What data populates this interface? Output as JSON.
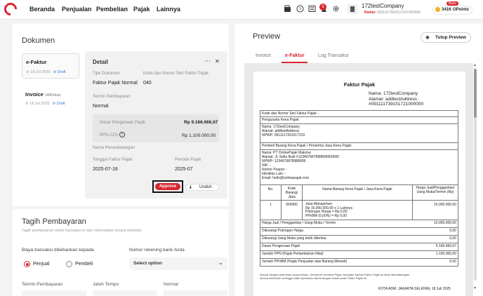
{
  "topbar": {
    "nav": [
      "Beranda",
      "Penjualan",
      "Pembelian",
      "Pajak",
      "Lainnya"
    ],
    "notif_count": "5",
    "company": "172testCompany",
    "badan_label": "Badan:",
    "badan_value": "0911117391517210-000000",
    "points": "341K OPoints",
    "baru": "Baru"
  },
  "left": {
    "dokumen_title": "Dokumen",
    "efaktur": {
      "title": "e-Faktur",
      "date": "18 Jul 2025",
      "status": "Draft"
    },
    "invoice": {
      "title": "Invoice",
      "number": "149Orkscl",
      "date": "18 Jul 2025",
      "status": "Draft"
    },
    "detail": {
      "title": "Detail",
      "tipe_label": "Tipe Dokumen",
      "tipe_value": "Faktur Pajak Normal",
      "kode_label": "Kode dan Nomor Seri Faktur Pajak",
      "kode_value": "040",
      "termin_label": "Termin Pembayaran",
      "termin_value": "Normal",
      "dpp_label": "Dasar Pengenaan Pajak",
      "dpp_value": "Rp 9.166.666,67",
      "ppn_label": "PPN-12%",
      "ppn_value": "Rp 1.100.000,00",
      "ttd_label": "Nama Penandatangan",
      "tanggal_label": "Tanggal Faktur Pajak",
      "tanggal_value": "2025-07-18",
      "periode_label": "Periode Pajak",
      "periode_value": "2025-07",
      "approve": "Approve",
      "unduh": "Unduh"
    },
    "tagih": {
      "title": "Tagih Pembayaran",
      "subtitle": "Tagih pembayaran untuk transaksi ini dan rekonsiliasi secara otomatis",
      "biaya_label": "Biaya transaksi dibebankan kepada",
      "opt1": "Penjual",
      "opt2": "Pembeli",
      "rek_label": "Nomor rekening bank Anda",
      "rek_placeholder": "Select option",
      "termin_label": "Termin Pembayaran",
      "jatuh_label": "Jatuh Tempo",
      "normal_label": "Normal"
    }
  },
  "preview": {
    "title": "Preview",
    "close": "Tutup Preview",
    "tabs": [
      "Invoice",
      "e-Faktur",
      "Log Transaksi"
    ],
    "doc": {
      "heading": "Faktur Pajak",
      "nama": "Nama: 172testCompany",
      "alamat": "Alamat: addtestAddress",
      "npwp_head": "#091111739151721000000",
      "kode": "Kode dan Nomor Seri Faktur Pajak: -",
      "pkp": "Pengusaha Kena Pajak:",
      "pkp_nama": "Nama: 172testCompany",
      "pkp_alamat": "Alamat: addtestAddress",
      "pkp_npwp": "NPWP: 0911117391517210",
      "pembeli": "Pembeli Barang Kena Pajak / Penerima Jasa Kena Pajak:",
      "b1": "Nama: PT OnlinePajak Makmur",
      "b2": "Alamat: Jl. Setia Budi #123467687898899900000",
      "b3": "NPWP: 1234676878988999",
      "b4": "NIK: -",
      "b5": "Nomor Paspor: -",
      "b6": "Identitas Lain: -",
      "b7": "Email: hello@onlinepajak.com",
      "col_no": "No.",
      "col_kode": "Kode Barang/ Jasa",
      "col_nama": "Nama Barang Kena Pajak / Jasa Kena Pajak",
      "col_harga": "Harga Jual/Penggantian/ Uang Muka/Termin (Rp)",
      "item_no": "1",
      "item_kode": "000000",
      "item_d1": "Jasa Manajemen",
      "item_d2": "Rp 10.000.000,00 x 1 Lainnya",
      "item_d3": "Potongan Harga = Rp 0,00",
      "item_d4": "PPnBM (0,00%) = Rp 0,00",
      "item_harga": "10.000.000,00",
      "t1": "Harga Jual / Penggantian / Uang Muka / Termin",
      "v1": "10.000.000,00",
      "t2": "Dikurangi Potongan Harga",
      "v2": "0,00",
      "t3": "Dikurangi Uang Muka yang telah diterima",
      "v3": "0,00",
      "t4": "Dasar Pengenaan Pajak",
      "v4": "9.166.666,67",
      "t5": "Jumlah PPN (Pajak Pertambahan Nilai)",
      "v5": "1.100.000,00",
      "t6": "Jumlah PPnBM (Pajak Penjualan atas Barang Mewah)",
      "v6": "0,00",
      "foot1": "Sesuai dengan ketentuan yang berlaku, Direktorat Jenderal Pajak mengatur bahwa Faktur Pajak ini telah ditandatangani",
      "foot2": "secara elektronik sehingga tidak diperlukan tanda tangan basah pada Faktur Pajak ini.",
      "kota": "KOTA ADM. JAKARTA SELATAN, 18 Juli 2025"
    }
  }
}
